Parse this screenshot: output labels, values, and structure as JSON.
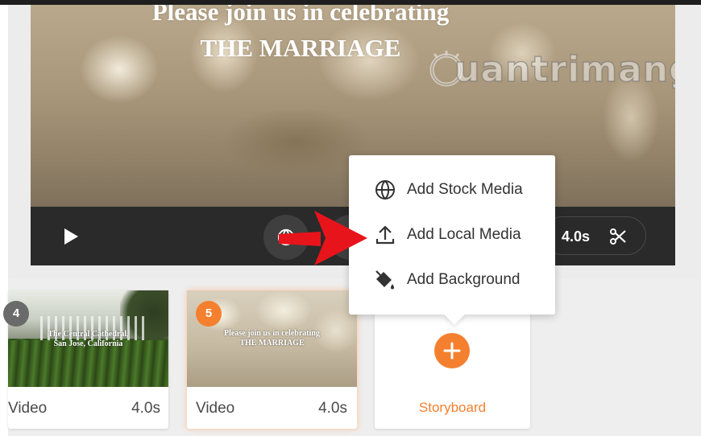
{
  "preview": {
    "title_line1": "Please join us in celebrating",
    "title_line2": "THE MARRIAGE",
    "watermark": "uantrimang"
  },
  "player": {
    "play_icon": "play-icon",
    "globe_icon": "globe-icon",
    "duration": "4.0s",
    "trim_icon": "scissors-icon"
  },
  "menu": {
    "items": [
      {
        "label": "Add Stock Media",
        "icon": "globe-icon"
      },
      {
        "label": "Add Local Media",
        "icon": "upload-icon"
      },
      {
        "label": "Add Background",
        "icon": "paint-bucket-icon"
      }
    ]
  },
  "storyboard": {
    "cards": [
      {
        "number": "4",
        "caption_line1": "The Central Cathedral,",
        "caption_line2": "San Jose, California",
        "type": "Video",
        "duration": "4.0s"
      },
      {
        "number": "5",
        "caption_line1": "Please join us in celebrating",
        "caption_line2": "THE MARRIAGE",
        "type": "Video",
        "duration": "4.0s",
        "selected": true
      }
    ],
    "add_label": "Storyboard"
  },
  "colors": {
    "accent": "#f4802f",
    "arrow": "#e8141b",
    "control_bar": "#2a2a2a"
  }
}
